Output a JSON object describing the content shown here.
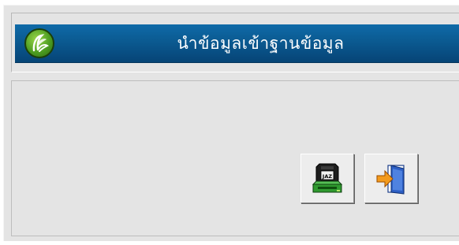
{
  "window": {
    "title": "นำข้อมูลเข้าฐานข้อมูล",
    "logo_icon": "leaf-logo-icon"
  },
  "toolbar": {
    "import_button_icon": "jaz-drive-icon",
    "exit_button_icon": "exit-door-icon"
  },
  "colors": {
    "title_bar": "#0b5a91",
    "panel_bg": "#e4e4e4",
    "logo_green": "#4d9d21"
  }
}
